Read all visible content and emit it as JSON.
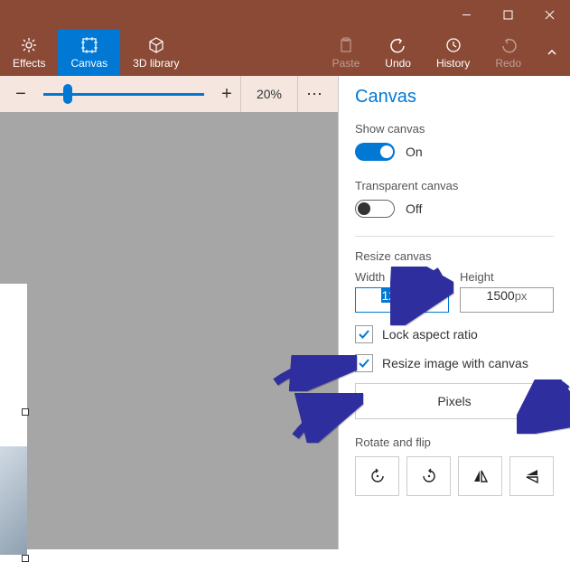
{
  "titlebar": {
    "minimize": "–",
    "maximize": "□",
    "close": "×"
  },
  "ribbon": {
    "effects": "Effects",
    "canvas": "Canvas",
    "library3d": "3D library",
    "paste": "Paste",
    "undo": "Undo",
    "history": "History",
    "redo": "Redo"
  },
  "zoom": {
    "percent": "20%"
  },
  "panel": {
    "title": "Canvas",
    "show_canvas_label": "Show canvas",
    "show_canvas_value": "On",
    "transparent_label": "Transparent canvas",
    "transparent_value": "Off",
    "resize_label": "Resize canvas",
    "width_label": "Width",
    "height_label": "Height",
    "width_value": "1200",
    "height_value": "1500",
    "unit_suffix": "px",
    "lock_aspect": "Lock aspect ratio",
    "resize_image": "Resize image with canvas",
    "units_dropdown": "Pixels",
    "rotate_flip_label": "Rotate and flip"
  }
}
